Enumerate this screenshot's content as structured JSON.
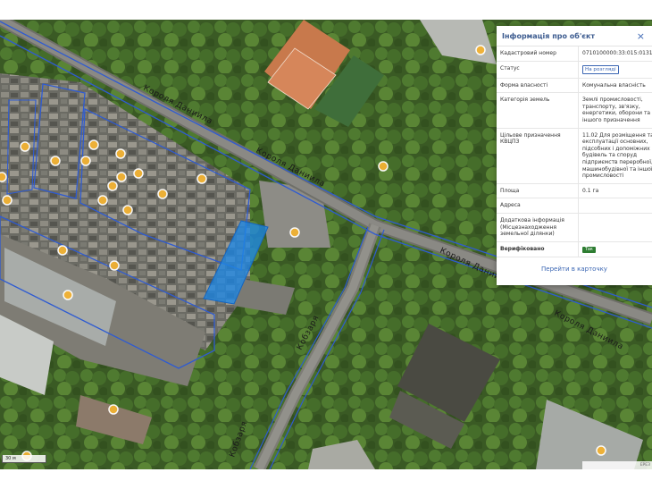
{
  "map": {
    "streets": [
      {
        "id": "north",
        "label": "Короля Даниила"
      },
      {
        "id": "middle",
        "label": "Короля Даниила"
      },
      {
        "id": "right",
        "label": "Короля Даниила"
      },
      {
        "id": "far-right",
        "label": "Короля Даниила"
      },
      {
        "id": "vertical",
        "label": "Кобзаря"
      },
      {
        "id": "bottom",
        "label": "Кобзаря"
      }
    ],
    "scale_label": "30 м",
    "attribution": "ЕРЕЗ"
  },
  "panel": {
    "title": "Інформація про об'єкт",
    "close": "×",
    "rows": {
      "cadastral": {
        "key": "Кадастровий номер",
        "value": "0710100000:33:015:0131"
      },
      "status": {
        "key": "Статус",
        "value": "На розгляді"
      },
      "ownership": {
        "key": "Форма власності",
        "value": "Комунальна власність"
      },
      "category": {
        "key": "Категорія земель",
        "value": "Землі промисловості, транспорту, зв'язку, енергетики, оборони та іншого призначення"
      },
      "purpose": {
        "key": "Цільове призначення КВЦПЗ",
        "value": "11.02 Для розміщення та експлуатації основних, підсобних і допоміжних будівель та споруд підприємств переробної, машинобудівної та іншої промисловості"
      },
      "area": {
        "key": "Площа",
        "value": "0.1 га"
      },
      "address": {
        "key": "Адреса",
        "value": ""
      },
      "extra": {
        "key": "Додаткова інформація (Місцезнаходження земельної ділянки)",
        "value": ""
      },
      "verified": {
        "key": "Верифіковано",
        "value": "Так"
      }
    },
    "goto_label": "Перейти в карточку"
  },
  "colors": {
    "accent": "#3b66b3",
    "parcel": "#1e88e5",
    "poi": "#f2b233",
    "verified": "#2e7d32"
  }
}
